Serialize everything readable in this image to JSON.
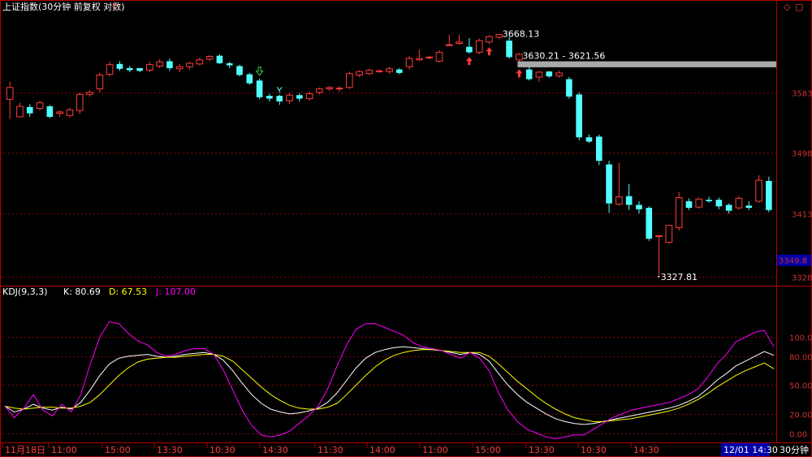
{
  "title": "上证指数(30分钟 前复权 对数)",
  "colors": {
    "up": "#ff3c3c",
    "down": "#54ffff",
    "grid": "#8a0000",
    "frame": "#b40000",
    "bg": "#000000",
    "K": "#ffffff",
    "D": "#ffff00",
    "J": "#ff00ff",
    "label_axis": "#c83232",
    "price_box": "#0000aa"
  },
  "icons": {
    "up_marker": "arrow-up-red",
    "down_marker": "arrow-down-green",
    "top_marker": "y-marker"
  },
  "price_panel": {
    "y_ticks": [
      "3583",
      "3498",
      "3413",
      "3328"
    ],
    "current_price": "3349.8",
    "annotations": {
      "high": "3668.13",
      "range": "3630.21 - 3621.56",
      "low": "3327.81"
    }
  },
  "kdj_panel": {
    "indicator": "KDJ(9,3,3)",
    "K_label": "K: 80.69",
    "D_label": "D: 67.53",
    "J_label": "J: 107.00",
    "y_ticks": [
      "100.00",
      "80.00",
      "50.00",
      "20.00",
      "0.00"
    ]
  },
  "x_axis": {
    "labels": [
      "11月18日",
      "11:00",
      "15:00",
      "13:30",
      "10:30",
      "14:30",
      "11:30",
      "14:00",
      "11:00",
      "15:00",
      "13:30",
      "10:30",
      "14:30"
    ],
    "highlight": "12/01 14:30",
    "period": "30分钟"
  },
  "chart_data": [
    {
      "type": "candlestick",
      "title": "上证指数(30分钟 前复权 对数)",
      "ylim": [
        3318,
        3700
      ],
      "y_ticks": [
        3583,
        3498,
        3413,
        3328
      ],
      "candles": [
        [
          3573,
          3590,
          3545,
          3598
        ],
        [
          3548,
          3563,
          3548,
          3568
        ],
        [
          3562,
          3553,
          3548,
          3566
        ],
        [
          3560,
          3568,
          3557,
          3571
        ],
        [
          3563,
          3548,
          3546,
          3565
        ],
        [
          3553,
          3555,
          3548,
          3557
        ],
        [
          3550,
          3558,
          3547,
          3561
        ],
        [
          3557,
          3580,
          3552,
          3583
        ],
        [
          3580,
          3583,
          3577,
          3586
        ],
        [
          3588,
          3608,
          3583,
          3611
        ],
        [
          3609,
          3623,
          3606,
          3627
        ],
        [
          3624,
          3617,
          3614,
          3628
        ],
        [
          3618,
          3615,
          3612,
          3621
        ],
        [
          3618,
          3614,
          3612,
          3618
        ],
        [
          3615,
          3623,
          3612,
          3627
        ],
        [
          3621,
          3627,
          3618,
          3631
        ],
        [
          3628,
          3618,
          3614,
          3632
        ],
        [
          3617,
          3620,
          3612,
          3624
        ],
        [
          3620,
          3625,
          3616,
          3627
        ],
        [
          3624,
          3630,
          3622,
          3633
        ],
        [
          3631,
          3635,
          3628,
          3637
        ],
        [
          3636,
          3625,
          3624,
          3638
        ],
        [
          3625,
          3622,
          3618,
          3627
        ],
        [
          3621,
          3608,
          3606,
          3623
        ],
        [
          3609,
          3596,
          3594,
          3611
        ],
        [
          3600,
          3576,
          3573,
          3603
        ],
        [
          3578,
          3574,
          3570,
          3581
        ],
        [
          3578,
          3570,
          3565,
          3580
        ],
        [
          3571,
          3579,
          3566,
          3582
        ],
        [
          3579,
          3574,
          3570,
          3582
        ],
        [
          3574,
          3581,
          3571,
          3584
        ],
        [
          3583,
          3588,
          3580,
          3590
        ],
        [
          3588,
          3590,
          3585,
          3592
        ],
        [
          3589,
          3589,
          3584,
          3592
        ],
        [
          3590,
          3610,
          3588,
          3613
        ],
        [
          3608,
          3613,
          3605,
          3615
        ],
        [
          3610,
          3615,
          3608,
          3617
        ],
        [
          3613,
          3614,
          3611,
          3616
        ],
        [
          3613,
          3617,
          3610,
          3620
        ],
        [
          3616,
          3611,
          3609,
          3618
        ],
        [
          3620,
          3632,
          3616,
          3636
        ],
        [
          3630,
          3632,
          3628,
          3645
        ],
        [
          3633,
          3634,
          3631,
          3636
        ],
        [
          3628,
          3641,
          3626,
          3644
        ],
        [
          3652,
          3652,
          3650,
          3667
        ],
        [
          3654,
          3656,
          3652,
          3667
        ],
        [
          3649,
          3641,
          3639,
          3662
        ],
        [
          3641,
          3658,
          3638,
          3661
        ],
        [
          3656,
          3664,
          3653,
          3666
        ],
        [
          3663,
          3667,
          3660,
          3668
        ],
        [
          3658,
          3634,
          3632,
          3664
        ],
        [
          3630,
          3638,
          3621,
          3640
        ],
        [
          3616,
          3602,
          3600,
          3621
        ],
        [
          3605,
          3612,
          3598,
          3614
        ],
        [
          3613,
          3606,
          3604,
          3614
        ],
        [
          3607,
          3611,
          3604,
          3614
        ],
        [
          3602,
          3577,
          3574,
          3605
        ],
        [
          3580,
          3519,
          3515,
          3583
        ],
        [
          3519,
          3513,
          3511,
          3523
        ],
        [
          3520,
          3486,
          3480,
          3523
        ],
        [
          3481,
          3427,
          3414,
          3486
        ],
        [
          3426,
          3436,
          3424,
          3483
        ],
        [
          3437,
          3425,
          3418,
          3454
        ],
        [
          3425,
          3419,
          3413,
          3430
        ],
        [
          3421,
          3379,
          3376,
          3423
        ],
        [
          3383,
          3383,
          3328,
          3383
        ],
        [
          3374,
          3397,
          3372,
          3398
        ],
        [
          3394,
          3435,
          3390,
          3443
        ],
        [
          3430,
          3421,
          3418,
          3434
        ],
        [
          3422,
          3433,
          3420,
          3435
        ],
        [
          3432,
          3430,
          3428,
          3436
        ],
        [
          3432,
          3423,
          3419,
          3435
        ],
        [
          3425,
          3417,
          3413,
          3427
        ],
        [
          3421,
          3434,
          3418,
          3437
        ],
        [
          3424,
          3421,
          3418,
          3430
        ],
        [
          3430,
          3459,
          3428,
          3466
        ],
        [
          3458,
          3418,
          3415,
          3464
        ]
      ],
      "annotations": {
        "high": 3668.13,
        "range_low": 3621.56,
        "range_high": 3630.21,
        "low": 3327.81,
        "current": 3349.8
      },
      "up_arrow_at": [
        46,
        48,
        51
      ],
      "down_arrow_at": [
        25
      ],
      "y_marker_at": [
        27
      ]
    },
    {
      "type": "line",
      "title": "KDJ(9,3,3)",
      "ylim": [
        -8,
        140
      ],
      "y_ticks": [
        100,
        80,
        50,
        20,
        0
      ],
      "series": [
        {
          "name": "K",
          "values": [
            28,
            22,
            25,
            30,
            26,
            24,
            27,
            25,
            32,
            45,
            60,
            72,
            78,
            80,
            81,
            82,
            80,
            79,
            80,
            82,
            83,
            84,
            82,
            76,
            65,
            52,
            40,
            31,
            25,
            22,
            20,
            21,
            23,
            26,
            32,
            42,
            55,
            68,
            78,
            84,
            87,
            89,
            90,
            89,
            88,
            87,
            86,
            84,
            82,
            84,
            82,
            75,
            62,
            50,
            40,
            32,
            26,
            20,
            15,
            12,
            10,
            9,
            10,
            12,
            14,
            16,
            18,
            20,
            22,
            24,
            26,
            29,
            33,
            38,
            46,
            55,
            62,
            70,
            75,
            80,
            85,
            81
          ]
        },
        {
          "name": "D",
          "values": [
            28,
            26,
            25,
            26,
            27,
            27,
            26,
            26,
            28,
            32,
            40,
            50,
            60,
            68,
            74,
            77,
            78,
            79,
            79,
            80,
            81,
            82,
            82,
            80,
            75,
            66,
            57,
            48,
            40,
            34,
            29,
            26,
            25,
            25,
            27,
            31,
            40,
            50,
            60,
            69,
            76,
            81,
            84,
            86,
            87,
            87,
            86,
            85,
            84,
            84,
            84,
            80,
            72,
            63,
            54,
            46,
            38,
            31,
            25,
            20,
            16,
            14,
            12,
            12,
            13,
            14,
            15,
            17,
            19,
            21,
            23,
            26,
            30,
            35,
            41,
            48,
            54,
            60,
            65,
            69,
            73,
            67
          ]
        },
        {
          "name": "J",
          "values": [
            28,
            16,
            26,
            40,
            24,
            18,
            30,
            22,
            40,
            72,
            100,
            116,
            114,
            104,
            96,
            92,
            84,
            80,
            82,
            86,
            88,
            88,
            82,
            66,
            45,
            24,
            8,
            -2,
            -4,
            -2,
            2,
            10,
            18,
            28,
            46,
            70,
            92,
            108,
            114,
            114,
            110,
            106,
            102,
            94,
            90,
            88,
            86,
            82,
            78,
            84,
            78,
            65,
            42,
            24,
            12,
            4,
            0,
            -4,
            -6,
            -4,
            -2,
            -2,
            4,
            10,
            16,
            20,
            24,
            26,
            28,
            30,
            32,
            36,
            40,
            46,
            58,
            72,
            82,
            95,
            100,
            105,
            107,
            90
          ]
        }
      ]
    }
  ]
}
